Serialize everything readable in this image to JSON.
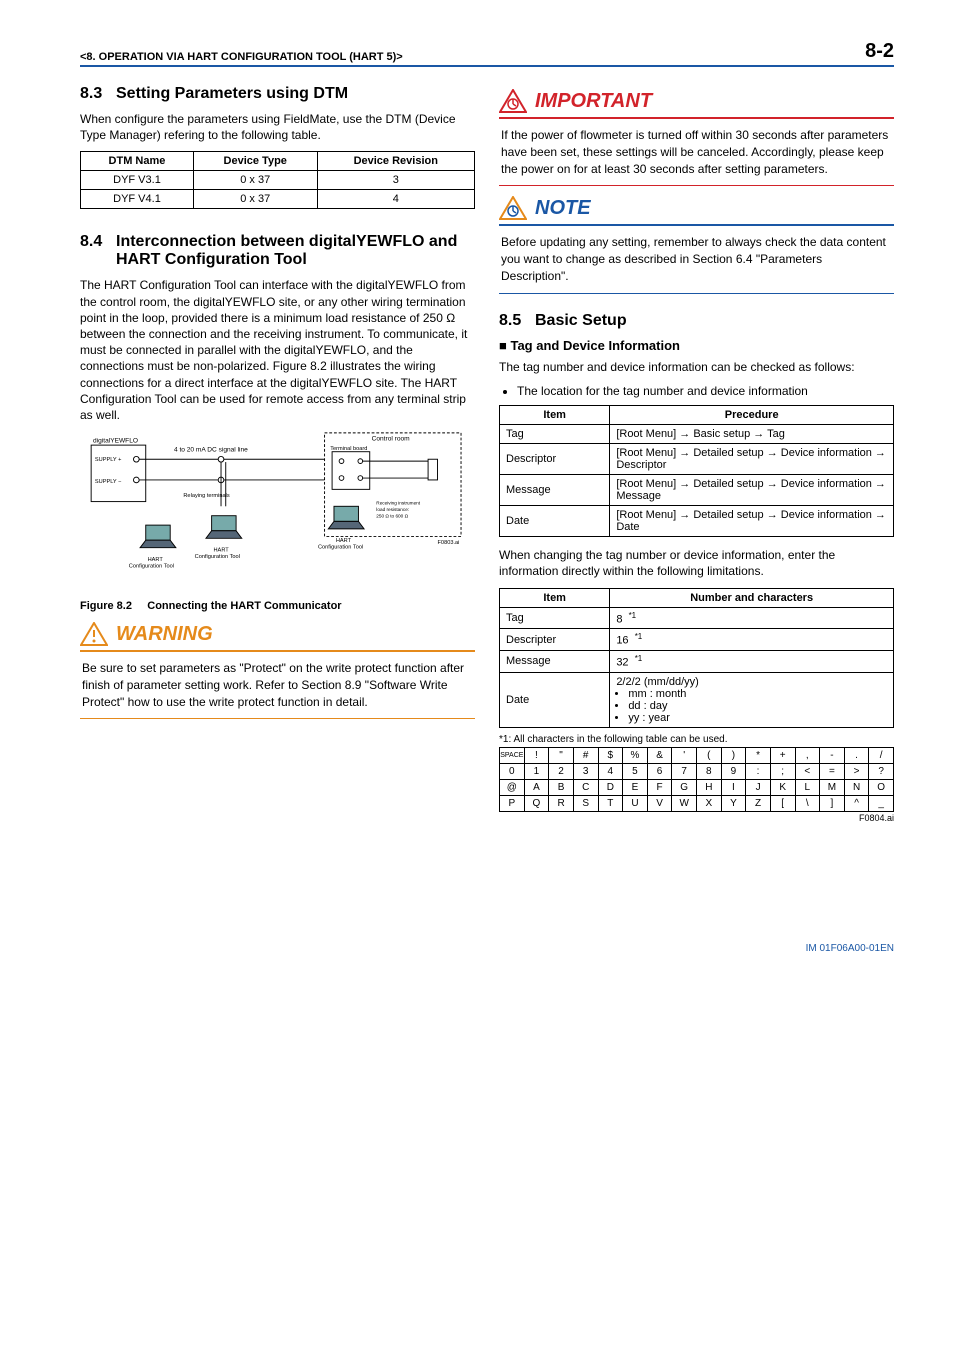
{
  "header": {
    "chapter_label": "<8.  OPERATION VIA HART CONFIGURATION TOOL (HART 5)>",
    "page_number": "8-2"
  },
  "sec83": {
    "heading_num": "8.3",
    "heading_text": "Setting Parameters using DTM",
    "para": "When configure the parameters using FieldMate, use the DTM (Device Type Manager) refering to the following table.",
    "table": {
      "headers": [
        "DTM Name",
        "Device Type",
        "Device Revision"
      ],
      "rows": [
        [
          "DYF V3.1",
          "0 x 37",
          "3"
        ],
        [
          "DYF V4.1",
          "0 x 37",
          "4"
        ]
      ]
    }
  },
  "sec84": {
    "heading_num": "8.4",
    "heading_text": "Interconnection between digitalYEWFLO and HART Configuration Tool",
    "para": "The HART Configuration Tool can interface with the digitalYEWFLO from the control room, the digitalYEWFLO site, or any other wiring termination point in the loop, provided there is a minimum load resistance of 250 Ω between the connection and the receiving instrument. To communicate, it must be connected in parallel with the digitalYEWFLO, and the connections must be non-polarized. Figure 8.2 illustrates the wiring connections for a direct interface at the digitalYEWFLO site. The HART Configuration Tool can be used for remote access from any terminal strip as well.",
    "figure": {
      "labels": {
        "flo": "digitalYEWFLO",
        "supply_plus": "SUPPLY +",
        "supply_minus": "SUPPLY −",
        "signal": "4 to 20 mA DC signal line",
        "relaying": "Relaying terminals",
        "control_room": "Control room",
        "terminal_board": "Terminal board",
        "hart_tool": "HART Configuration Tool",
        "load": "Receiving instrument load resistance: 250 Ω to 600 Ω",
        "figref": "F0803.ai"
      },
      "caption_label": "Figure 8.2",
      "caption_text": "Connecting the HART Communicator"
    }
  },
  "warning": {
    "title": "WARNING",
    "body": "Be sure to set parameters as \"Protect\" on the write protect function after finish of parameter setting work. Refer to Section 8.9 \"Software Write Protect\" how to use the write protect function in detail."
  },
  "important": {
    "title": "IMPORTANT",
    "body": "If the power of flowmeter is turned off within 30 seconds after parameters have been set, these settings will be canceled. Accordingly, please keep the power on for at least 30 seconds after setting parameters."
  },
  "note": {
    "title": "NOTE",
    "body": "Before updating any setting, remember to always check the data content you want to change as described in Section 6.4 \"Parameters Description\"."
  },
  "sec85": {
    "heading_num": "8.5",
    "heading_text": "Basic Setup",
    "subhead": "Tag and Device Information",
    "para1": "The tag number and device information can be checked as follows:",
    "bullet1": "The location for the tag number and device information",
    "table1": {
      "headers": [
        "Item",
        "Precedure"
      ],
      "rows": [
        [
          "Tag",
          "[Root Menu] → Basic setup → Tag"
        ],
        [
          "Descriptor",
          "[Root Menu] → Detailed setup → Device information → Descriptor"
        ],
        [
          "Message",
          "[Root Menu] → Detailed setup → Device information → Message"
        ],
        [
          "Date",
          "[Root Menu] → Detailed setup → Device information → Date"
        ]
      ]
    },
    "para2": "When changing the tag number or device information, enter the information directly within the following limitations.",
    "table2": {
      "headers": [
        "Item",
        "Number and characters"
      ],
      "rows": [
        {
          "item": "Tag",
          "val": "8",
          "note": "*1"
        },
        {
          "item": "Descripter",
          "val": "16",
          "note": "*1"
        },
        {
          "item": "Message",
          "val": "32",
          "note": "*1"
        },
        {
          "item": "Date",
          "date": {
            "fmt": "2/2/2 (mm/dd/yy)",
            "lines": [
              "mm : month",
              "dd : day",
              "yy : year"
            ]
          }
        }
      ]
    },
    "footnote": "*1: All characters in the following table can be used.",
    "chargrid": [
      [
        "SPACE",
        "!",
        "\"",
        "#",
        "$",
        "%",
        "&",
        "'",
        "(",
        ")",
        "*",
        "+",
        ",",
        "-",
        ".",
        "/"
      ],
      [
        "0",
        "1",
        "2",
        "3",
        "4",
        "5",
        "6",
        "7",
        "8",
        "9",
        ":",
        ";",
        "<",
        "=",
        ">",
        "?"
      ],
      [
        "@",
        "A",
        "B",
        "C",
        "D",
        "E",
        "F",
        "G",
        "H",
        "I",
        "J",
        "K",
        "L",
        "M",
        "N",
        "O"
      ],
      [
        "P",
        "Q",
        "R",
        "S",
        "T",
        "U",
        "V",
        "W",
        "X",
        "Y",
        "Z",
        "[",
        "\\",
        "]",
        "^",
        "_"
      ]
    ],
    "gridref": "F0804.ai"
  },
  "footer": {
    "doc_id": "IM 01F06A00-01EN"
  },
  "icons": {
    "warning": "warning-triangle",
    "important": "important-triangle",
    "note": "note-triangle"
  }
}
